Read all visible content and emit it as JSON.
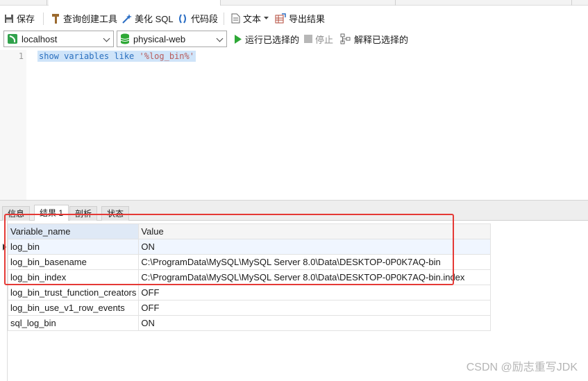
{
  "toolbar": {
    "save": "保存",
    "query_builder": "查询创建工具",
    "beautify_sql": "美化 SQL",
    "code_snippet": "代码段",
    "text": "文本",
    "export_result": "导出结果"
  },
  "connection": {
    "server": "localhost",
    "database": "physical-web",
    "run_selected": "运行已选择的",
    "stop": "停止",
    "explain_selected": "解释已选择的"
  },
  "editor": {
    "line_number": "1",
    "sql_prefix": "show variables like ",
    "sql_string": "'%log_bin%'"
  },
  "result_tabs": [
    "信息",
    "结果 1",
    "剖析",
    "状态"
  ],
  "grid": {
    "columns": [
      "Variable_name",
      "Value"
    ],
    "rows": [
      [
        "log_bin",
        "ON"
      ],
      [
        "log_bin_basename",
        "C:\\ProgramData\\MySQL\\MySQL Server 8.0\\Data\\DESKTOP-0P0K7AQ-bin"
      ],
      [
        "log_bin_index",
        "C:\\ProgramData\\MySQL\\MySQL Server 8.0\\Data\\DESKTOP-0P0K7AQ-bin.index"
      ],
      [
        "log_bin_trust_function_creators",
        "OFF"
      ],
      [
        "log_bin_use_v1_row_events",
        "OFF"
      ],
      [
        "sql_log_bin",
        "ON"
      ]
    ]
  },
  "watermark": "CSDN @励志重写JDK",
  "colors": {
    "highlight_box": "#e53935",
    "run_icon": "#2ea836",
    "selection": "#cfe4f9"
  }
}
